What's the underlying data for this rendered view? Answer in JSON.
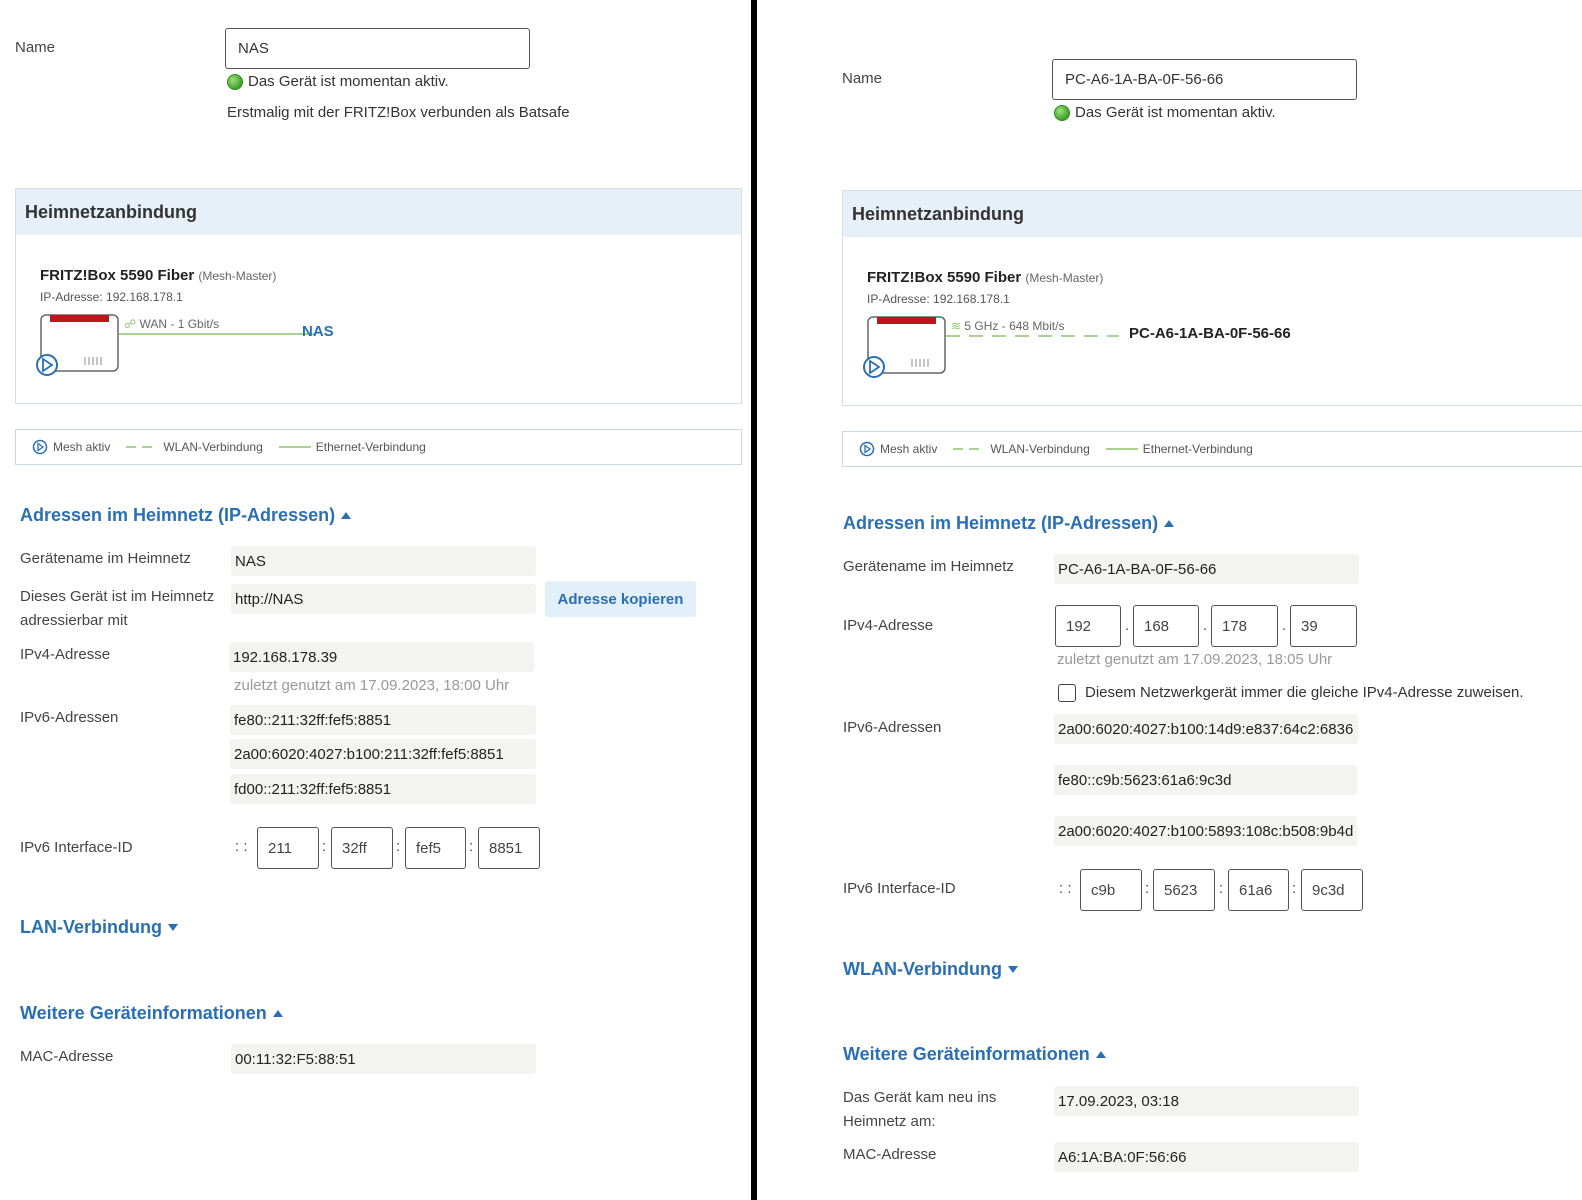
{
  "left": {
    "name_label": "Name",
    "name_value": "NAS",
    "status": "Das Gerät ist momentan aktiv.",
    "first_connected": "Erstmalig mit der FRITZ!Box verbunden als Batsafe",
    "heimnetz_title": "Heimnetzanbindung",
    "router_name": "FRITZ!Box 5590 Fiber",
    "router_role": "(Mesh-Master)",
    "router_ip": "IP-Adresse: 192.168.178.1",
    "link_label": "WAN - 1 Gbit/s",
    "device_name": "NAS",
    "legend": {
      "mesh": "Mesh aktiv",
      "wlan": "WLAN-Verbindung",
      "ethernet": "Ethernet-Verbindung"
    },
    "addr_section": "Adressen im Heimnetz (IP-Adressen)",
    "devname_label": "Gerätename im Heimnetz",
    "devname_value": "NAS",
    "reachable_label_1": "Dieses Gerät ist im Heimnetz",
    "reachable_label_2": "adressierbar mit",
    "reachable_value": "http://NAS",
    "copy_button": "Adresse kopieren",
    "ipv4_label": "IPv4-Adresse",
    "ipv4_value": "192.168.178.39",
    "last_used": "zuletzt genutzt am 17.09.2023, 18:00 Uhr",
    "ipv6_label": "IPv6-Adressen",
    "ipv6_values": [
      "fe80::211:32ff:fef5:8851",
      "2a00:6020:4027:b100:211:32ff:fef5:8851",
      "fd00::211:32ff:fef5:8851"
    ],
    "ifid_label": "IPv6 Interface-ID",
    "ifid_prefix": ": :",
    "ifid_values": [
      "211",
      "32ff",
      "fef5",
      "8851"
    ],
    "conn_section": "LAN-Verbindung",
    "more_section": "Weitere Geräteinformationen",
    "mac_label": "MAC-Adresse",
    "mac_value": "00:11:32:F5:88:51"
  },
  "right": {
    "name_label": "Name",
    "name_value": "PC-A6-1A-BA-0F-56-66",
    "status": "Das Gerät ist momentan aktiv.",
    "heimnetz_title": "Heimnetzanbindung",
    "router_name": "FRITZ!Box 5590 Fiber",
    "router_role": "(Mesh-Master)",
    "router_ip": "IP-Adresse: 192.168.178.1",
    "link_label": "5 GHz - 648 Mbit/s",
    "device_name": "PC-A6-1A-BA-0F-56-66",
    "legend": {
      "mesh": "Mesh aktiv",
      "wlan": "WLAN-Verbindung",
      "ethernet": "Ethernet-Verbindung"
    },
    "addr_section": "Adressen im Heimnetz (IP-Adressen)",
    "devname_label": "Gerätename im Heimnetz",
    "devname_value": "PC-A6-1A-BA-0F-56-66",
    "ipv4_label": "IPv4-Adresse",
    "ipv4_octets": [
      "192",
      "168",
      "178",
      "39"
    ],
    "last_used": "zuletzt genutzt am 17.09.2023, 18:05 Uhr",
    "same_ip_checkbox": "Diesem Netzwerkgerät immer die gleiche IPv4-Adresse zuweisen.",
    "ipv6_label": "IPv6-Adressen",
    "ipv6_values": [
      "2a00:6020:4027:b100:14d9:e837:64c2:6836",
      "fe80::c9b:5623:61a6:9c3d",
      "2a00:6020:4027:b100:5893:108c:b508:9b4d"
    ],
    "ifid_label": "IPv6 Interface-ID",
    "ifid_prefix": ": :",
    "ifid_values": [
      "c9b",
      "5623",
      "61a6",
      "9c3d"
    ],
    "conn_section": "WLAN-Verbindung",
    "more_section": "Weitere Geräteinformationen",
    "joined_label_1": "Das Gerät kam neu ins",
    "joined_label_2": "Heimnetz am:",
    "joined_value": "17.09.2023, 03:18",
    "mac_label": "MAC-Adresse",
    "mac_value": "A6:1A:BA:0F:56:66"
  },
  "colors": {
    "accent": "#2a6fb3",
    "panel_head": "#e7f0f8",
    "router_red": "#c0141c",
    "link_green": "#8cc66a",
    "status_green": "#3ea22b"
  }
}
